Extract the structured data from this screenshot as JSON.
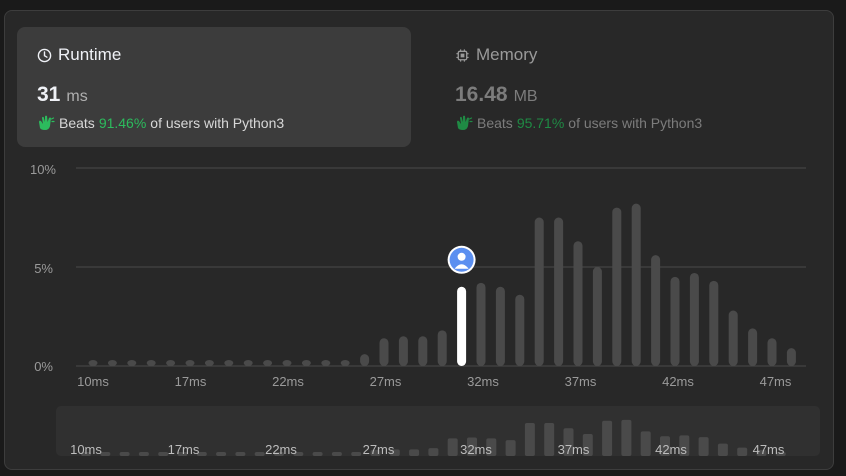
{
  "runtime": {
    "title": "Runtime",
    "icon": "clock-icon",
    "value": "31",
    "unit": "ms",
    "beats_label": "Beats",
    "beats_pct": "91.46%",
    "beats_suffix": "of users with Python3"
  },
  "memory": {
    "title": "Memory",
    "icon": "chip-icon",
    "value": "16.48",
    "unit": "MB",
    "beats_label": "Beats",
    "beats_pct": "95.71%",
    "beats_suffix": "of users with Python3"
  },
  "colors": {
    "accent_green": "#2cbb5d",
    "bar": "#4a4a4a",
    "bar_highlight": "#ffffff",
    "avatar": "#5b8ff0"
  },
  "chart_data": {
    "type": "bar",
    "ylabel_ticks": [
      "10%",
      "5%",
      "0%"
    ],
    "ylim": [
      0,
      10
    ],
    "x_tick_labels": [
      "10ms",
      "17ms",
      "22ms",
      "27ms",
      "32ms",
      "37ms",
      "42ms",
      "47ms"
    ],
    "categories": [
      "10ms",
      "11ms",
      "12ms",
      "13ms",
      "14ms",
      "15ms",
      "16ms",
      "17ms",
      "18ms",
      "19ms",
      "20ms",
      "21ms",
      "22ms",
      "23ms",
      "24ms",
      "25ms",
      "26ms",
      "27ms",
      "28ms",
      "29ms",
      "30ms",
      "31ms",
      "32ms",
      "33ms",
      "34ms",
      "35ms",
      "36ms",
      "37ms",
      "38ms",
      "39ms",
      "40ms",
      "41ms",
      "42ms",
      "43ms",
      "44ms",
      "45ms",
      "46ms",
      "47ms",
      "48ms",
      "49ms"
    ],
    "values": [
      0.3,
      0.3,
      0.3,
      0.3,
      0.3,
      0.3,
      0.3,
      0.3,
      0.3,
      0.3,
      0.3,
      0.3,
      0.3,
      0.3,
      0.6,
      1.4,
      1.5,
      1.5,
      1.8,
      4.0,
      4.2,
      4.0,
      3.6,
      7.5,
      7.5,
      6.3,
      5.0,
      8.0,
      8.2,
      5.6,
      4.5,
      4.7,
      4.3,
      2.8,
      1.9,
      1.4,
      0.9
    ],
    "highlight_index": 19,
    "grid": true
  },
  "overview": {
    "x_tick_labels": [
      "10ms",
      "17ms",
      "22ms",
      "27ms",
      "32ms",
      "37ms",
      "42ms",
      "47ms"
    ]
  }
}
